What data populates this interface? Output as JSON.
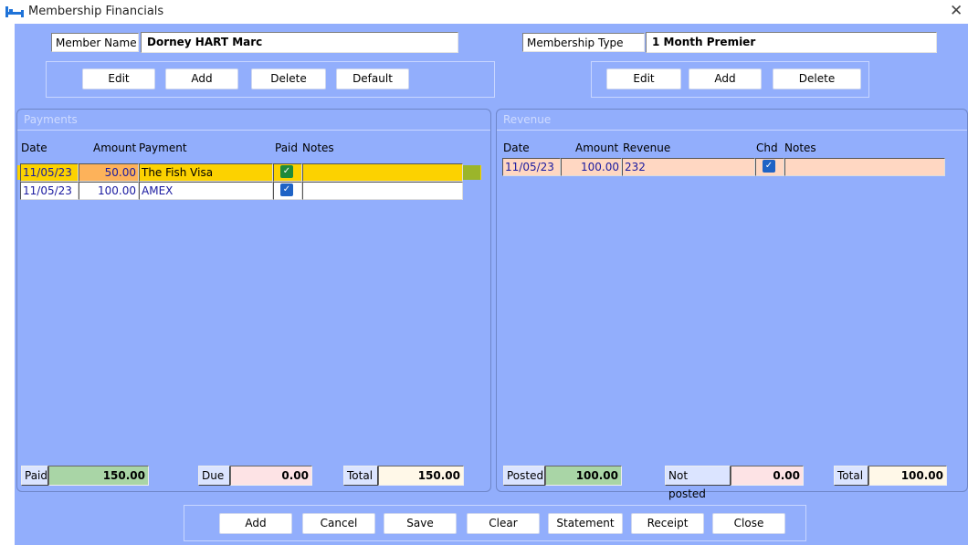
{
  "window": {
    "title": "Membership Financials"
  },
  "member": {
    "label": "Member Name",
    "value": "Dorney HART Marc"
  },
  "membership_type": {
    "label": "Membership Type",
    "value": "1 Month Premier"
  },
  "member_buttons": {
    "edit": "Edit",
    "add": "Add",
    "delete": "Delete",
    "default": "Default"
  },
  "type_buttons": {
    "edit": "Edit",
    "add": "Add",
    "delete": "Delete"
  },
  "payments": {
    "title": "Payments",
    "headers": {
      "date": "Date",
      "amount": "Amount",
      "payment": "Payment",
      "paid": "Paid",
      "notes": "Notes"
    },
    "rows": [
      {
        "date": "11/05/23",
        "amount": "50.00",
        "payment": "The Fish Visa",
        "paid": true,
        "notes": ""
      },
      {
        "date": "11/05/23",
        "amount": "100.00",
        "payment": "AMEX",
        "paid": true,
        "notes": ""
      }
    ],
    "summary": {
      "paid_label": "Paid",
      "paid_value": "150.00",
      "due_label": "Due",
      "due_value": "0.00",
      "total_label": "Total",
      "total_value": "150.00"
    }
  },
  "revenue": {
    "title": "Revenue",
    "headers": {
      "date": "Date",
      "amount": "Amount",
      "revenue": "Revenue",
      "chd": "Chd",
      "notes": "Notes"
    },
    "rows": [
      {
        "date": "11/05/23",
        "amount": "100.00",
        "revenue": "232",
        "chd": true,
        "notes": ""
      }
    ],
    "summary": {
      "posted_label": "Posted",
      "posted_value": "100.00",
      "not_posted_label": "Not posted",
      "not_posted_value": "0.00",
      "total_label": "Total",
      "total_value": "100.00"
    }
  },
  "footer_buttons": {
    "add": "Add",
    "cancel": "Cancel",
    "save": "Save",
    "clear": "Clear",
    "statement": "Statement",
    "receipt": "Receipt",
    "close": "Close"
  },
  "colors": {
    "client_bg": "#92aefc",
    "selected_row": "#fcd200",
    "amount_highlight": "#fdb25a",
    "revenue_row": "#ffd7c2",
    "paid_bg": "#a9d5a6",
    "due_bg": "#fde3e5",
    "total_bg": "#fff8e8",
    "checkbox_blue": "#1f63c5",
    "checkbox_green": "#1f8a3b"
  }
}
